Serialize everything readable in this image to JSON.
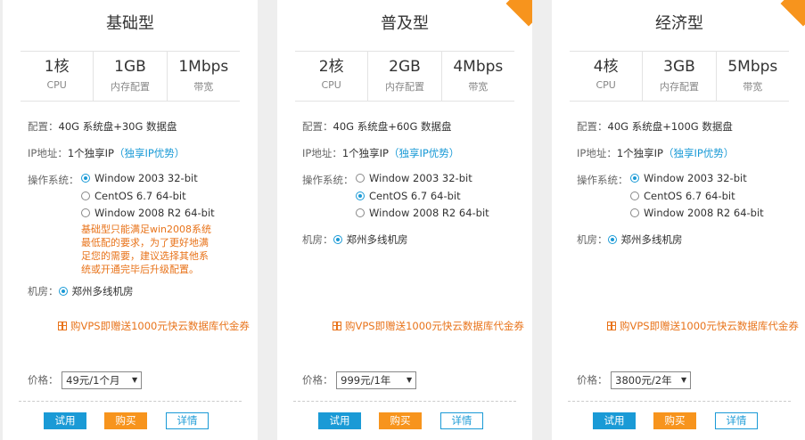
{
  "plans": [
    {
      "title": "基础型",
      "specs": [
        {
          "value": "1核",
          "label": "CPU"
        },
        {
          "value": "1GB",
          "label": "内存配置"
        },
        {
          "value": "1Mbps",
          "label": "带宽"
        }
      ],
      "config_label": "配置：",
      "config_value": "40G 系统盘+30G 数据盘",
      "ip_label": "IP地址：",
      "ip_value": "1个独享IP",
      "ip_link": "（独享IP优势）",
      "os_label": "操作系统：",
      "os_options": [
        {
          "label": "Window 2003 32-bit",
          "selected": true
        },
        {
          "label": "CentOS 6.7 64-bit",
          "selected": false
        },
        {
          "label": "Window 2008 R2 64-bit",
          "selected": false
        }
      ],
      "note": "基础型只能满足win2008系统最低配的要求，为了更好地满足您的需要，建议选择其他系统或开通完毕后升级配置。",
      "room_label": "机房：",
      "room_value": "郑州多线机房",
      "gift": "购VPS即赠送1000元快云数据库代金券",
      "price_label": "价格：",
      "price_value": "49元/1个月",
      "buttons": {
        "try": "试用",
        "buy": "购买",
        "info": "详情"
      }
    },
    {
      "title": "普及型",
      "specs": [
        {
          "value": "2核",
          "label": "CPU"
        },
        {
          "value": "2GB",
          "label": "内存配置"
        },
        {
          "value": "4Mbps",
          "label": "带宽"
        }
      ],
      "config_label": "配置：",
      "config_value": "40G 系统盘+60G 数据盘",
      "ip_label": "IP地址：",
      "ip_value": "1个独享IP",
      "ip_link": "（独享IP优势）",
      "os_label": "操作系统：",
      "os_options": [
        {
          "label": "Window 2003 32-bit",
          "selected": false
        },
        {
          "label": "CentOS 6.7 64-bit",
          "selected": true
        },
        {
          "label": "Window 2008 R2 64-bit",
          "selected": false
        }
      ],
      "room_label": "机房：",
      "room_value": "郑州多线机房",
      "gift": "购VPS即赠送1000元快云数据库代金券",
      "price_label": "价格：",
      "price_value": "999元/1年",
      "buttons": {
        "try": "试用",
        "buy": "购买",
        "info": "详情"
      }
    },
    {
      "title": "经济型",
      "specs": [
        {
          "value": "4核",
          "label": "CPU"
        },
        {
          "value": "3GB",
          "label": "内存配置"
        },
        {
          "value": "5Mbps",
          "label": "带宽"
        }
      ],
      "config_label": "配置：",
      "config_value": "40G 系统盘+100G 数据盘",
      "ip_label": "IP地址：",
      "ip_value": "1个独享IP",
      "ip_link": "（独享IP优势）",
      "os_label": "操作系统：",
      "os_options": [
        {
          "label": "Window 2003 32-bit",
          "selected": true
        },
        {
          "label": "CentOS 6.7 64-bit",
          "selected": false
        },
        {
          "label": "Window 2008 R2 64-bit",
          "selected": false
        }
      ],
      "room_label": "机房：",
      "room_value": "郑州多线机房",
      "gift": "购VPS即赠送1000元快云数据库代金券",
      "price_label": "价格：",
      "price_value": "3800元/2年",
      "buttons": {
        "try": "试用",
        "buy": "购买",
        "info": "详情"
      }
    }
  ],
  "colors": {
    "accent_blue": "#1a9ad6",
    "accent_orange": "#f7941d"
  }
}
